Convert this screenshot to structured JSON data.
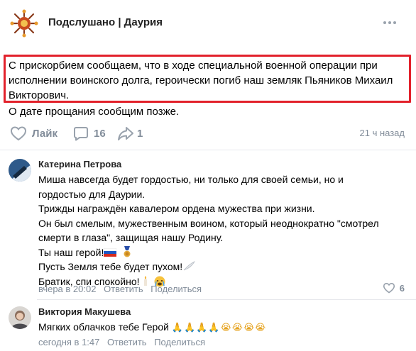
{
  "post": {
    "group_name": "Подслушано | Даурия",
    "text_highlighted": "С прискорбием сообщаем, что в ходе специальной военной операции при исполнении воинского долга, героически погиб наш земляк Пьяников Михаил Викторович.",
    "text_rest": "О дате прощания сообщим позже.",
    "actions": {
      "like_label": "Лайк",
      "comments_count": "16",
      "shares_count": "1"
    },
    "time_ago": "21 ч назад"
  },
  "comments": [
    {
      "author": "Катерина Петрова",
      "lines": [
        "Миша навсегда будет гордостью, ни только для своей семьи, но и",
        "гордостью для Даурии.",
        "Трижды награждён кавалером ордена мужества при жизни.",
        "Он был смелым, мужественным воином, который неоднократно \"смотрел",
        "смерти в глаза\", защищая нашу Родину.",
        "Ты наш герой!",
        "Пусть Земля тебе будет пухом!",
        "Братик, спи спокойно!"
      ],
      "time": "вчера в 20:02",
      "reply_label": "Ответить",
      "share_label": "Поделиться",
      "likes": "6"
    },
    {
      "author": "Виктория Макушева",
      "text": "Мягких облачков тебе Герой",
      "emojis": "🙏🙏🙏🙏😭😭😭😭",
      "time": "сегодня в 1:47",
      "reply_label": "Ответить",
      "share_label": "Поделиться"
    }
  ],
  "colors": {
    "highlight_border": "#e2212b",
    "muted": "#818c99",
    "icon": "#99a2ad",
    "divider": "#e7e8ec"
  },
  "icons": [
    "group-logo-icon",
    "more-dots-icon",
    "heart-icon",
    "comment-icon",
    "share-icon",
    "russia-flag-icon",
    "medal-icon",
    "feather-icon",
    "candle-icon",
    "crying-face-icon",
    "praying-hands-icon"
  ]
}
